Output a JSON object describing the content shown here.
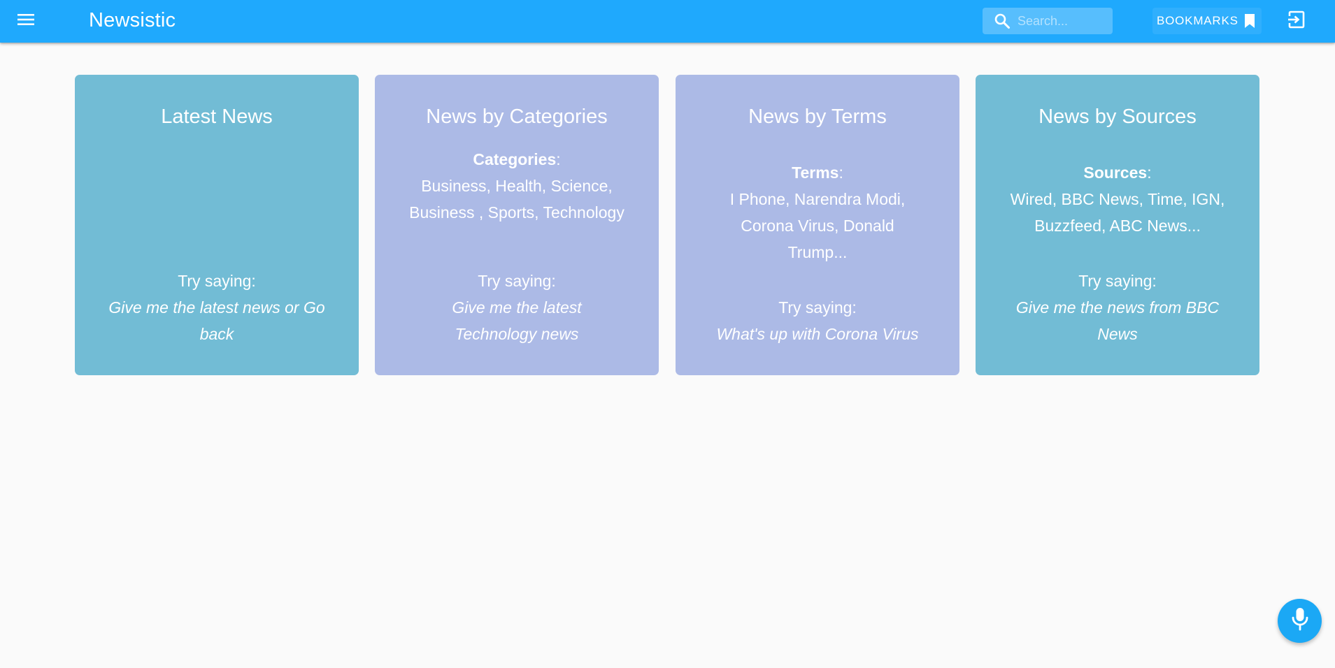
{
  "appbar": {
    "title": "Newsistic",
    "search_placeholder": "Search...",
    "bookmarks_label": "BOOKMARKS",
    "color": "#1fa9fd"
  },
  "cards": [
    {
      "title": "Latest News",
      "info_label": "",
      "info_text": "",
      "try_label": "Try saying:",
      "try_example": "Give me the latest news or Go back",
      "color": "#72bcd5"
    },
    {
      "title": "News by Categories",
      "info_label": "Categories",
      "info_text": "Business, Health, Science, Business , Sports, Technology",
      "try_label": "Try saying:",
      "try_example": "Give me the latest Technology news",
      "color": "#acbae6"
    },
    {
      "title": "News by Terms",
      "info_label": "Terms",
      "info_text": "I Phone, Narendra Modi, Corona Virus, Donald Trump...",
      "try_label": "Try saying:",
      "try_example": "What's up with Corona Virus",
      "color": "#acbae6"
    },
    {
      "title": "News by Sources",
      "info_label": "Sources",
      "info_text": "Wired, BBC News, Time, IGN, Buzzfeed, ABC News...",
      "try_label": "Try saying:",
      "try_example": "Give me the news from BBC News",
      "color": "#72bcd5"
    }
  ],
  "icons": {
    "menu": "menu-icon",
    "search": "search-icon",
    "bookmark": "bookmark-icon",
    "logout": "logout-icon",
    "mic": "mic-icon"
  },
  "mic_button_color": "#1ba8f5"
}
